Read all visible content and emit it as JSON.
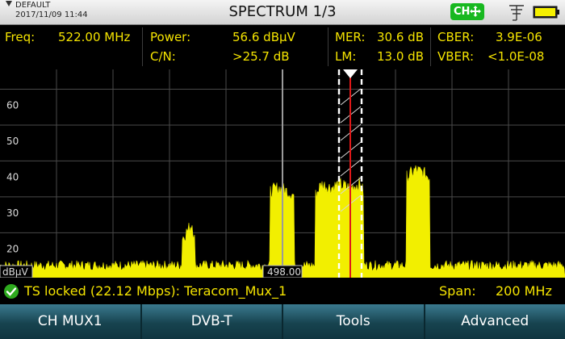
{
  "header": {
    "preset": "DEFAULT",
    "datetime": "2017/11/09 11:44",
    "title": "SPECTRUM 1/3",
    "ch_badge": "CH",
    "battery_color": "#f5f000",
    "badge_color": "#17b81f"
  },
  "measurements": {
    "freq_label": "Freq:",
    "freq_value": "522.00 MHz",
    "power_label": "Power:",
    "power_value": "56.6 dBµV",
    "cn_label": "C/N:",
    "cn_value": ">25.7 dB",
    "mer_label": "MER:",
    "mer_value": "30.6 dB",
    "lm_label": "LM:",
    "lm_value": "13.0 dB",
    "cber_label": "CBER:",
    "cber_value": "3.9E-06",
    "vber_label": "VBER:",
    "vber_value": "<1.0E-08"
  },
  "plot": {
    "y_ticks": [
      "60",
      "50",
      "40",
      "30",
      "20"
    ],
    "unit_label": "dBµV",
    "marker_readout": "498.00"
  },
  "status": {
    "lock_text": "TS locked (22.12 Mbps): Teracom_Mux_1",
    "span_label": "Span:",
    "span_value": "200 MHz"
  },
  "softkeys": [
    "CH MUX1",
    "DVB-T",
    "Tools",
    "Advanced"
  ],
  "chart_data": {
    "type": "area",
    "title": "SPECTRUM 1/3",
    "xlabel": "",
    "ylabel": "dBµV",
    "ylim": [
      12,
      70
    ],
    "span_mhz": 200,
    "center_freq_mhz": 522.0,
    "series": [
      {
        "points": [
          [
            0,
            14
          ],
          [
            50,
            14
          ],
          [
            90,
            14
          ],
          [
            100,
            14
          ],
          [
            160,
            14
          ],
          [
            225,
            14
          ],
          [
            226,
            23
          ],
          [
            238,
            27
          ],
          [
            241,
            23
          ],
          [
            242,
            14
          ],
          [
            300,
            14
          ],
          [
            334,
            14
          ],
          [
            335,
            36
          ],
          [
            345,
            37
          ],
          [
            356,
            36
          ],
          [
            364,
            35
          ],
          [
            365,
            14
          ],
          [
            390,
            14
          ],
          [
            391,
            35
          ],
          [
            398,
            38
          ],
          [
            410,
            37
          ],
          [
            420,
            38
          ],
          [
            432,
            37
          ],
          [
            445,
            38
          ],
          [
            450,
            36
          ],
          [
            451,
            14
          ],
          [
            490,
            14
          ],
          [
            503,
            14
          ],
          [
            504,
            40
          ],
          [
            515,
            42
          ],
          [
            525,
            41
          ],
          [
            532,
            40
          ],
          [
            533,
            14
          ],
          [
            600,
            14
          ],
          [
            650,
            14
          ],
          [
            700,
            14
          ]
        ]
      }
    ],
    "gridlines": true
  }
}
